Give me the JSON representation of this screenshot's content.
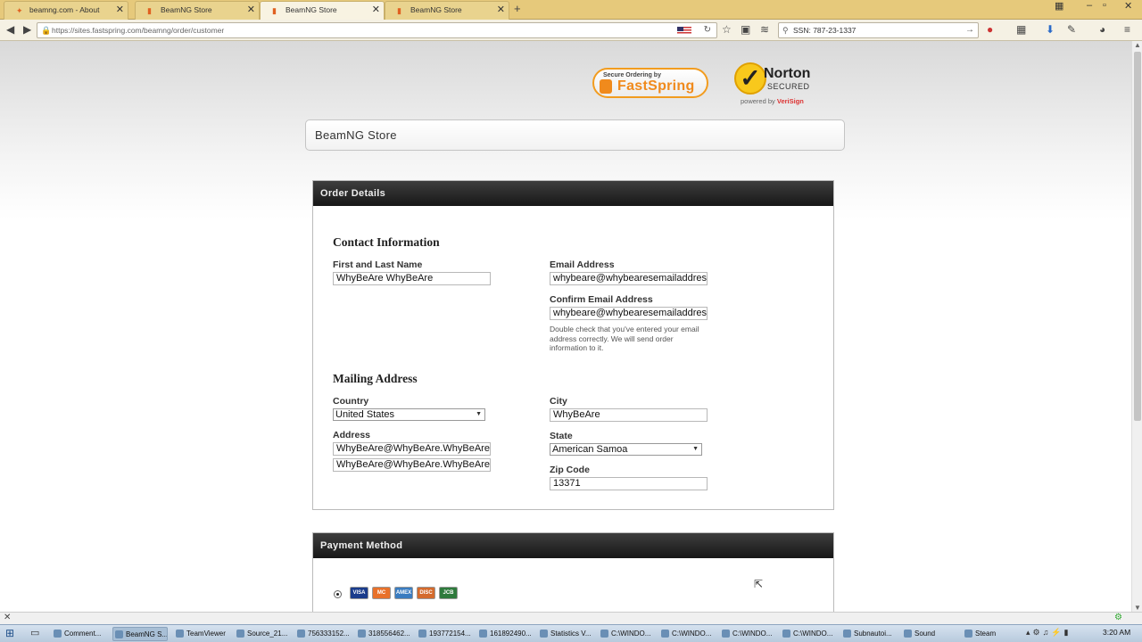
{
  "tabs": [
    {
      "label": "beamng.com - About"
    },
    {
      "label": "BeamNG Store"
    },
    {
      "label": "BeamNG Store"
    },
    {
      "label": "BeamNG Store"
    }
  ],
  "nav": {
    "url": "https://sites.fastspring.com/beamng/order/customer",
    "search": "SSN: 787-23-1337"
  },
  "badges": {
    "fastspring_top": "Secure Ordering by",
    "fastspring_name": "FastSpring",
    "norton_name": "Norton",
    "norton_secured": "SECURED",
    "norton_powered": "powered by",
    "norton_verisign": "VeriSign"
  },
  "store_title": "BeamNG Store",
  "order": {
    "header": "Order Details",
    "contact_heading": "Contact Information",
    "name_label": "First and Last Name",
    "name_value": "WhyBeAre WhyBeAre",
    "email_label": "Email Address",
    "email_value": "whybeare@whybearesemailaddress",
    "confirm_label": "Confirm Email Address",
    "confirm_value": "whybeare@whybearesemailaddress",
    "email_hint": "Double check that you've entered your email address correctly. We will send order information to it.",
    "mailing_heading": "Mailing Address",
    "country_label": "Country",
    "country_value": "United States",
    "city_label": "City",
    "city_value": "WhyBeAre",
    "address_label": "Address",
    "address1_value": "WhyBeAre@WhyBeAre.WhyBeAre",
    "address2_value": "WhyBeAre@WhyBeAre.WhyBeAre",
    "state_label": "State",
    "state_value": "American Samoa",
    "zip_label": "Zip Code",
    "zip_value": "13371"
  },
  "payment": {
    "header": "Payment Method",
    "cards": [
      "VISA",
      "MC",
      "AMEX",
      "DISC",
      "JCB"
    ]
  },
  "taskbar": {
    "items": [
      "Comment...",
      "BeamNG S...",
      "TeamViewer",
      "Source_21...",
      "756333152...",
      "318556462...",
      "193772154...",
      "161892490...",
      "Statistics V...",
      "C:\\WINDO...",
      "C:\\WINDO...",
      "C:\\WINDO...",
      "C:\\WINDO...",
      "Subnautoi...",
      "Sound",
      "Steam"
    ],
    "clock": "3:20 AM"
  }
}
